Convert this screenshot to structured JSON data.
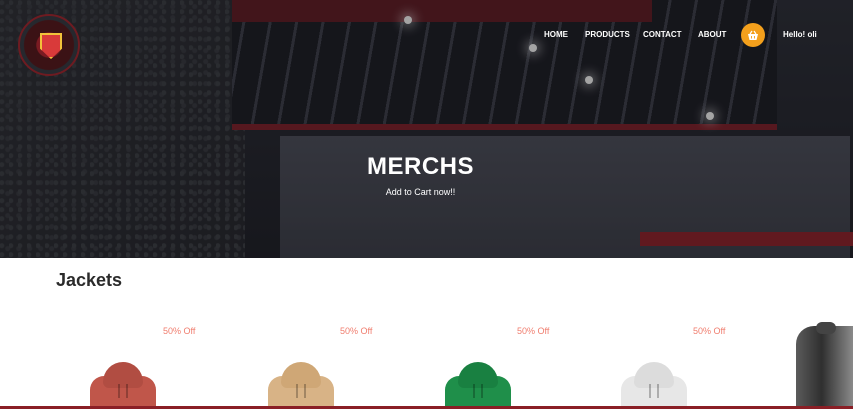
{
  "nav": {
    "items": [
      "HOME",
      "PRODUCTS",
      "CONTACT",
      "ABOUT"
    ],
    "greeting": "Hello! oli",
    "cart_icon": "basket-icon"
  },
  "hero": {
    "title": "MERCHS",
    "subtitle": "Add to Cart now!!"
  },
  "section": {
    "title": "Jackets"
  },
  "products": [
    {
      "discount": "50% Off",
      "color": "#c0564a"
    },
    {
      "discount": "50% Off",
      "color": "#d8b386"
    },
    {
      "discount": "50% Off",
      "color": "#1f8f4a"
    },
    {
      "discount": "50% Off",
      "color": "#e7e7e7"
    }
  ],
  "colors": {
    "accent": "#f4a01c",
    "discount": "#f07d6e",
    "brand_red": "#8a1f26"
  }
}
